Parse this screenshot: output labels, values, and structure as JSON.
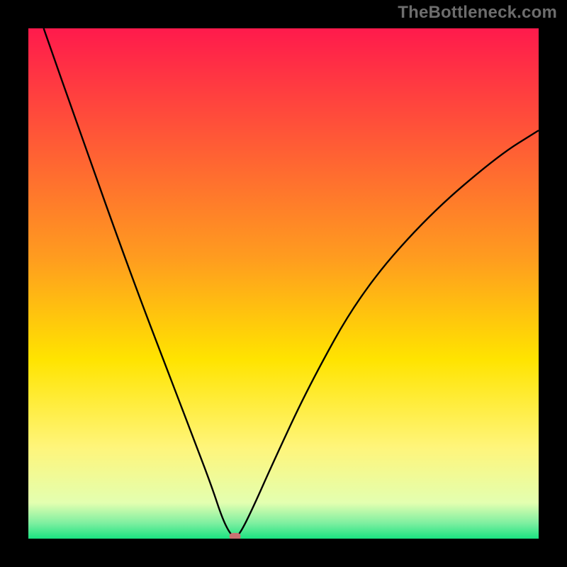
{
  "watermark": "TheBottleneck.com",
  "chart_data": {
    "type": "line",
    "title": "",
    "xlabel": "",
    "ylabel": "",
    "xlim": [
      0,
      100
    ],
    "ylim": [
      0,
      100
    ],
    "yaxis_inverted": false,
    "gradient_stops": [
      {
        "offset": 0.0,
        "color": "#ff1a4c"
      },
      {
        "offset": 0.45,
        "color": "#ff9c1f"
      },
      {
        "offset": 0.65,
        "color": "#ffe400"
      },
      {
        "offset": 0.82,
        "color": "#fff57a"
      },
      {
        "offset": 0.93,
        "color": "#e3ffb0"
      },
      {
        "offset": 0.97,
        "color": "#7defa0"
      },
      {
        "offset": 1.0,
        "color": "#1ae281"
      }
    ],
    "series": [
      {
        "name": "bottleneck-curve",
        "x": [
          3,
          10,
          20,
          28,
          33,
          36,
          38,
          39.5,
          40.5,
          41.5,
          44,
          48,
          55,
          65,
          78,
          92,
          100
        ],
        "y": [
          100,
          80,
          52,
          31,
          18,
          10,
          4,
          1,
          0.3,
          1,
          6,
          15,
          30,
          48,
          63,
          75,
          80
        ]
      }
    ],
    "marker": {
      "name": "optimal-point",
      "x": 40.5,
      "y": 0.3
    }
  }
}
